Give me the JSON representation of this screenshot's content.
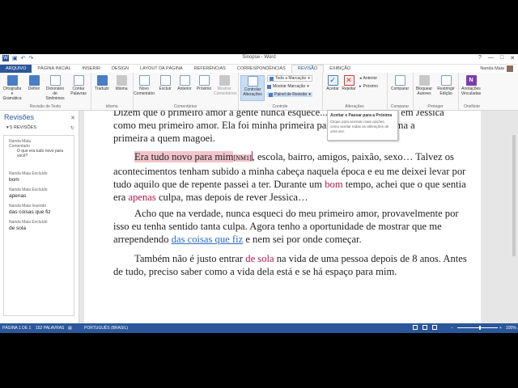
{
  "window": {
    "title": "Sinopse - Word",
    "qat_icons": [
      "word-icon",
      "save-icon",
      "undo-icon",
      "redo-icon"
    ],
    "controls": [
      "?",
      "—",
      "□",
      "✕"
    ]
  },
  "tabs": [
    {
      "label": "ARQUIVO"
    },
    {
      "label": "PÁGINA INICIAL"
    },
    {
      "label": "INSERIR"
    },
    {
      "label": "DESIGN"
    },
    {
      "label": "LAYOUT DA PÁGINA"
    },
    {
      "label": "REFERÊNCIAS"
    },
    {
      "label": "CORRESPONDÊNCIAS"
    },
    {
      "label": "REVISÃO"
    },
    {
      "label": "EXIBIÇÃO"
    }
  ],
  "active_tab": "REVISÃO",
  "user": {
    "name": "Nanda Maia"
  },
  "ribbon": {
    "groups": {
      "revisao_texto": "Revisão de Texto",
      "idioma": "Idioma",
      "comentarios": "Comentários",
      "controle": "Controle",
      "alteracoes": "Alterações",
      "comparar": "Comparar",
      "proteger": "Proteger",
      "onenote": "OneNote"
    },
    "buttons": {
      "ortografia": "Ortografia e Gramática",
      "definir": "Definir",
      "sinonimos": "Dicionário de Sinônimos",
      "contar": "Contar Palavras",
      "traduzir": "Traduzir",
      "idioma": "Idioma",
      "novo_comentario": "Novo Comentário",
      "excluir": "Excluir",
      "anterior": "Anterior",
      "proximo": "Próximo",
      "mostrar_comentarios": "Mostrar Comentários",
      "controlar_alteracoes": "Controlar Alterações",
      "aceitar": "Aceitar",
      "rejeitar": "Rejeitar",
      "comparar": "Comparar",
      "bloquear_autores": "Bloquear Autores",
      "restringir_edicao": "Restringir Edição",
      "anotacoes": "Anotações Vinculadas"
    },
    "controle": {
      "markup_select": "Toda a Marcação",
      "mostrar_marcacao": "Mostrar Marcação",
      "painel_revisao": "Painel de Revisão"
    },
    "alteracoes": {
      "anterior": "Anterior",
      "proximo": "Próximo"
    }
  },
  "tooltip": {
    "title": "Aceitar e Passar para a Próxima",
    "body": "Clique para acessar mais opções, como aceitar todas as alterações de uma vez."
  },
  "revisions_pane": {
    "title": "Revisões",
    "count": "5 REVISÕES",
    "items": [
      {
        "header": "Nanda Maia Comentado",
        "text": "O que era tudo novo para você?"
      },
      {
        "header": "Nanda Maia Excluído",
        "text": "bom"
      },
      {
        "header": "Nanda Maia Excluído",
        "text": "apenas"
      },
      {
        "header": "Nanda Maia Inserido",
        "text": "das coisas que fiz"
      },
      {
        "header": "Nanda Maia Excluído",
        "text": "de sola"
      }
    ]
  },
  "document": {
    "p1": {
      "l1": "Dizem que o primeiro amor a gente nunca esquece... e que eu conheci em Jessica",
      "l2": "como meu primeiro amor. Ela foi minha primeira paixão, de certa forma a",
      "l3": "primeira a quem magoei."
    },
    "p2": {
      "commented": "Era tudo novo para mim",
      "comment_marker": "[NM1]",
      "a": ", escola, bairro, amigos, paixão, sexo… Talvez os",
      "l2": "acontecimentos tenham subido a minha cabeça naquela época e eu me deixei levar por",
      "l3a": "tudo aquilo que de repente passei a ter. Durante um ",
      "del1": "bom",
      "l3b": " tempo, achei que o que sentia",
      "l4a": "era ",
      "del2": "apenas",
      "l4b": " culpa, mas depois de rever Jessica…"
    },
    "p3": {
      "l1": "Acho que na verdade, nunca esqueci do meu primeiro amor, provavelmente por",
      "l2": "isso eu tenha sentido tanta culpa. Agora tenho a oportunidade de mostrar que me",
      "l3a": "arrependendo ",
      "ins1": "das coisas que fiz",
      "l3b": " e nem sei por onde começar."
    },
    "p4": {
      "l1a": "Também não é justo entrar ",
      "del3": "de sola",
      "l1b": " na vida de uma pessoa depois de 8 anos. Antes",
      "l2": "de tudo, preciso saber como a vida dela está e se há espaço para mim."
    }
  },
  "status": {
    "page": "PÁGINA 1 DE 1",
    "words": "152 PALAVRAS",
    "lang": "PORTUGUÊS (BRASIL)",
    "zoom": "100%"
  },
  "colors": {
    "brand": "#2b579a",
    "deleted": "#b5174a",
    "inserted": "#2a6cc4",
    "comment_highlight": "#f2c4cc"
  }
}
